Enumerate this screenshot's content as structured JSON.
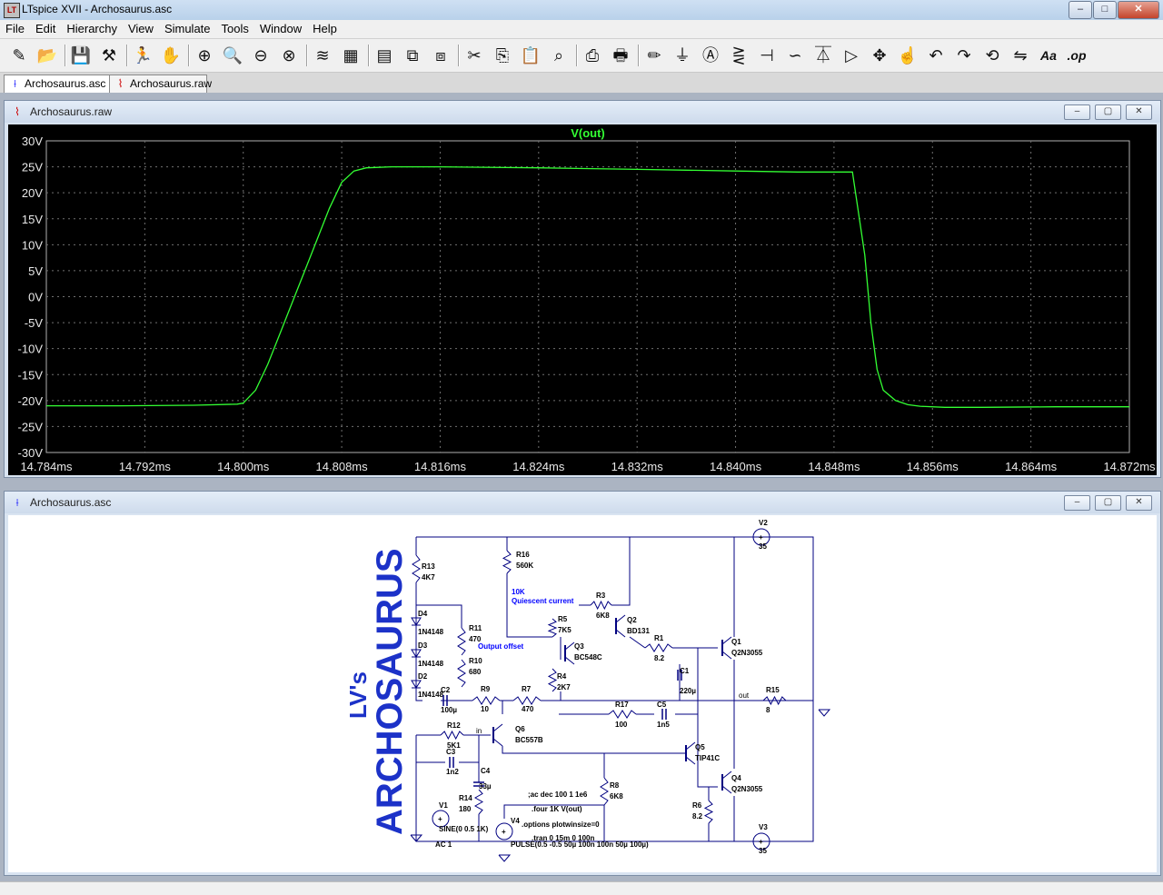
{
  "window": {
    "title": "LTspice XVII - Archosaurus.asc",
    "app_icon": "ltspice-icon",
    "min": "–",
    "max": "□",
    "close": "✕"
  },
  "menu": [
    "File",
    "Edit",
    "Hierarchy",
    "View",
    "Simulate",
    "Tools",
    "Window",
    "Help"
  ],
  "toolbar": [
    {
      "name": "new-schematic-icon",
      "glyph": "✎"
    },
    {
      "name": "open-icon",
      "glyph": "📂"
    },
    {
      "name": "save-icon",
      "glyph": "💾"
    },
    {
      "name": "control-panel-icon",
      "glyph": "⚒"
    },
    {
      "name": "run-icon",
      "glyph": "🏃"
    },
    {
      "name": "halt-icon",
      "glyph": "✋"
    },
    {
      "name": "zoom-in-icon",
      "glyph": "⊕"
    },
    {
      "name": "pan-icon",
      "glyph": "🔍"
    },
    {
      "name": "zoom-out-icon",
      "glyph": "⊖"
    },
    {
      "name": "zoom-fit-icon",
      "glyph": "⊗"
    },
    {
      "name": "autorange-icon",
      "glyph": "≋"
    },
    {
      "name": "plot-settings-icon",
      "glyph": "▦"
    },
    {
      "name": "tile-horizontal-icon",
      "glyph": "▤"
    },
    {
      "name": "cascade-icon",
      "glyph": "⧉"
    },
    {
      "name": "tile-vertical-icon",
      "glyph": "⧈"
    },
    {
      "name": "cut-icon",
      "glyph": "✂"
    },
    {
      "name": "copy-icon",
      "glyph": "⎘"
    },
    {
      "name": "paste-icon",
      "glyph": "📋"
    },
    {
      "name": "find-icon",
      "glyph": "⌕"
    },
    {
      "name": "print-setup-icon",
      "glyph": "⎙"
    },
    {
      "name": "print-icon",
      "glyph": "🖶"
    },
    {
      "name": "draw-wire-icon",
      "glyph": "✏"
    },
    {
      "name": "ground-icon",
      "glyph": "⏚"
    },
    {
      "name": "label-net-icon",
      "glyph": "Ⓐ"
    },
    {
      "name": "resistor-icon",
      "glyph": "⋛"
    },
    {
      "name": "capacitor-icon",
      "glyph": "⊣"
    },
    {
      "name": "inductor-icon",
      "glyph": "∽"
    },
    {
      "name": "diode-icon",
      "glyph": "⏄"
    },
    {
      "name": "component-icon",
      "glyph": "▷"
    },
    {
      "name": "move-icon",
      "glyph": "✥"
    },
    {
      "name": "drag-icon",
      "glyph": "☝"
    },
    {
      "name": "undo-icon",
      "glyph": "↶"
    },
    {
      "name": "redo-icon",
      "glyph": "↷"
    },
    {
      "name": "rotate-icon",
      "glyph": "⟲"
    },
    {
      "name": "mirror-icon",
      "glyph": "⇋"
    },
    {
      "name": "text-icon",
      "glyph": "Aa"
    },
    {
      "name": "spice-directive-icon",
      "glyph": ".op"
    }
  ],
  "tabs": [
    {
      "label": "Archosaurus.asc",
      "icon": "schematic-icon"
    },
    {
      "label": "Archosaurus.raw",
      "icon": "waveform-icon"
    }
  ],
  "plot_window": {
    "title": "Archosaurus.raw",
    "icon": "waveform-icon"
  },
  "schematic_window": {
    "title": "Archosaurus.asc",
    "icon": "schematic-icon"
  },
  "child_buttons": {
    "min": "–",
    "max": "▢",
    "close": "✕"
  },
  "chart_data": {
    "type": "line",
    "title": "",
    "series": [
      {
        "name": "V(out)",
        "color": "#33ff33",
        "x": [
          14.784,
          14.79,
          14.796,
          14.7995,
          14.8,
          14.801,
          14.802,
          14.803,
          14.804,
          14.805,
          14.806,
          14.807,
          14.808,
          14.809,
          14.81,
          14.811,
          14.812,
          14.816,
          14.824,
          14.832,
          14.84,
          14.845,
          14.848,
          14.849,
          14.8495,
          14.8505,
          14.851,
          14.8515,
          14.852,
          14.853,
          14.854,
          14.855,
          14.857,
          14.86,
          14.866,
          14.872
        ],
        "y": [
          -21,
          -21,
          -20.9,
          -20.7,
          -20.5,
          -18,
          -13,
          -7,
          -1,
          5,
          11,
          17,
          22,
          24.2,
          24.8,
          24.9,
          25,
          25,
          24.8,
          24.5,
          24.2,
          24,
          24,
          24,
          24,
          8,
          -5,
          -14,
          -18,
          -20,
          -20.8,
          -21.1,
          -21.3,
          -21.3,
          -21.2,
          -21.2
        ]
      }
    ],
    "xticks": [
      "14.784ms",
      "14.792ms",
      "14.800ms",
      "14.808ms",
      "14.816ms",
      "14.824ms",
      "14.832ms",
      "14.840ms",
      "14.848ms",
      "14.856ms",
      "14.864ms",
      "14.872ms"
    ],
    "yticks": [
      "30V",
      "25V",
      "20V",
      "15V",
      "10V",
      "5V",
      "0V",
      "-5V",
      "-10V",
      "-15V",
      "-20V",
      "-25V",
      "-30V"
    ],
    "xlim": [
      14.784,
      14.872
    ],
    "ylim": [
      -30,
      30
    ],
    "grid": true
  },
  "schematic": {
    "logo_line1": "LV's",
    "logo_line2": "ARCHOSAURUS",
    "color_part": "#000080",
    "color_wire": "#000080",
    "color_directive": "#000000",
    "color_note": "#0000ff",
    "components": [
      {
        "ref": "R13",
        "value": "4K7"
      },
      {
        "ref": "R16",
        "value": "560K"
      },
      {
        "ref": "D4",
        "value": "1N4148"
      },
      {
        "ref": "D3",
        "value": "1N4148"
      },
      {
        "ref": "D2",
        "value": "1N4148"
      },
      {
        "ref": "R11",
        "value": "470"
      },
      {
        "ref": "R10",
        "value": "680"
      },
      {
        "ref": "C2",
        "value": "100µ"
      },
      {
        "ref": "R9",
        "value": "10"
      },
      {
        "ref": "R7",
        "value": "470"
      },
      {
        "ref": "R5",
        "value": "7K5"
      },
      {
        "ref": "Q3",
        "value": "BC548C"
      },
      {
        "ref": "R4",
        "value": "2K7"
      },
      {
        "ref": "R3",
        "value": "6K8"
      },
      {
        "ref": "Q2",
        "value": "BD131"
      },
      {
        "ref": "R1",
        "value": "8.2"
      },
      {
        "ref": "C1",
        "value": "220µ"
      },
      {
        "ref": "Q1",
        "value": "Q2N3055"
      },
      {
        "ref": "V2",
        "value": "35"
      },
      {
        "ref": "R15",
        "value": "8"
      },
      {
        "ref": "R17",
        "value": "100"
      },
      {
        "ref": "C5",
        "value": "1n5"
      },
      {
        "ref": "R12",
        "value": "5K1"
      },
      {
        "ref": "Q6",
        "value": "BC557B"
      },
      {
        "ref": "C3",
        "value": "1n2"
      },
      {
        "ref": "C4",
        "value": "33µ"
      },
      {
        "ref": "R14",
        "value": "180"
      },
      {
        "ref": "Q5",
        "value": "TIP41C"
      },
      {
        "ref": "R8",
        "value": "6K8"
      },
      {
        "ref": "Q4",
        "value": "Q2N3055"
      },
      {
        "ref": "R6",
        "value": "8.2"
      },
      {
        "ref": "V3",
        "value": "35"
      },
      {
        "ref": "V1",
        "value": "SINE(0 0.5 1K)"
      },
      {
        "ref": "V4",
        "value": "PULSE(0.5 -0.5 50µ 100n 100n 50µ 100µ)"
      }
    ],
    "v1_ac": "AC 1",
    "net_in": "in",
    "net_out": "out",
    "notes": [
      "10K",
      "Quiescent current",
      "Output offset"
    ],
    "directives": [
      ";ac dec 100 1 1e6",
      ".four 1K V(out)",
      ".options plotwinsize=0",
      ".tran 0 15m 0 100n"
    ]
  }
}
